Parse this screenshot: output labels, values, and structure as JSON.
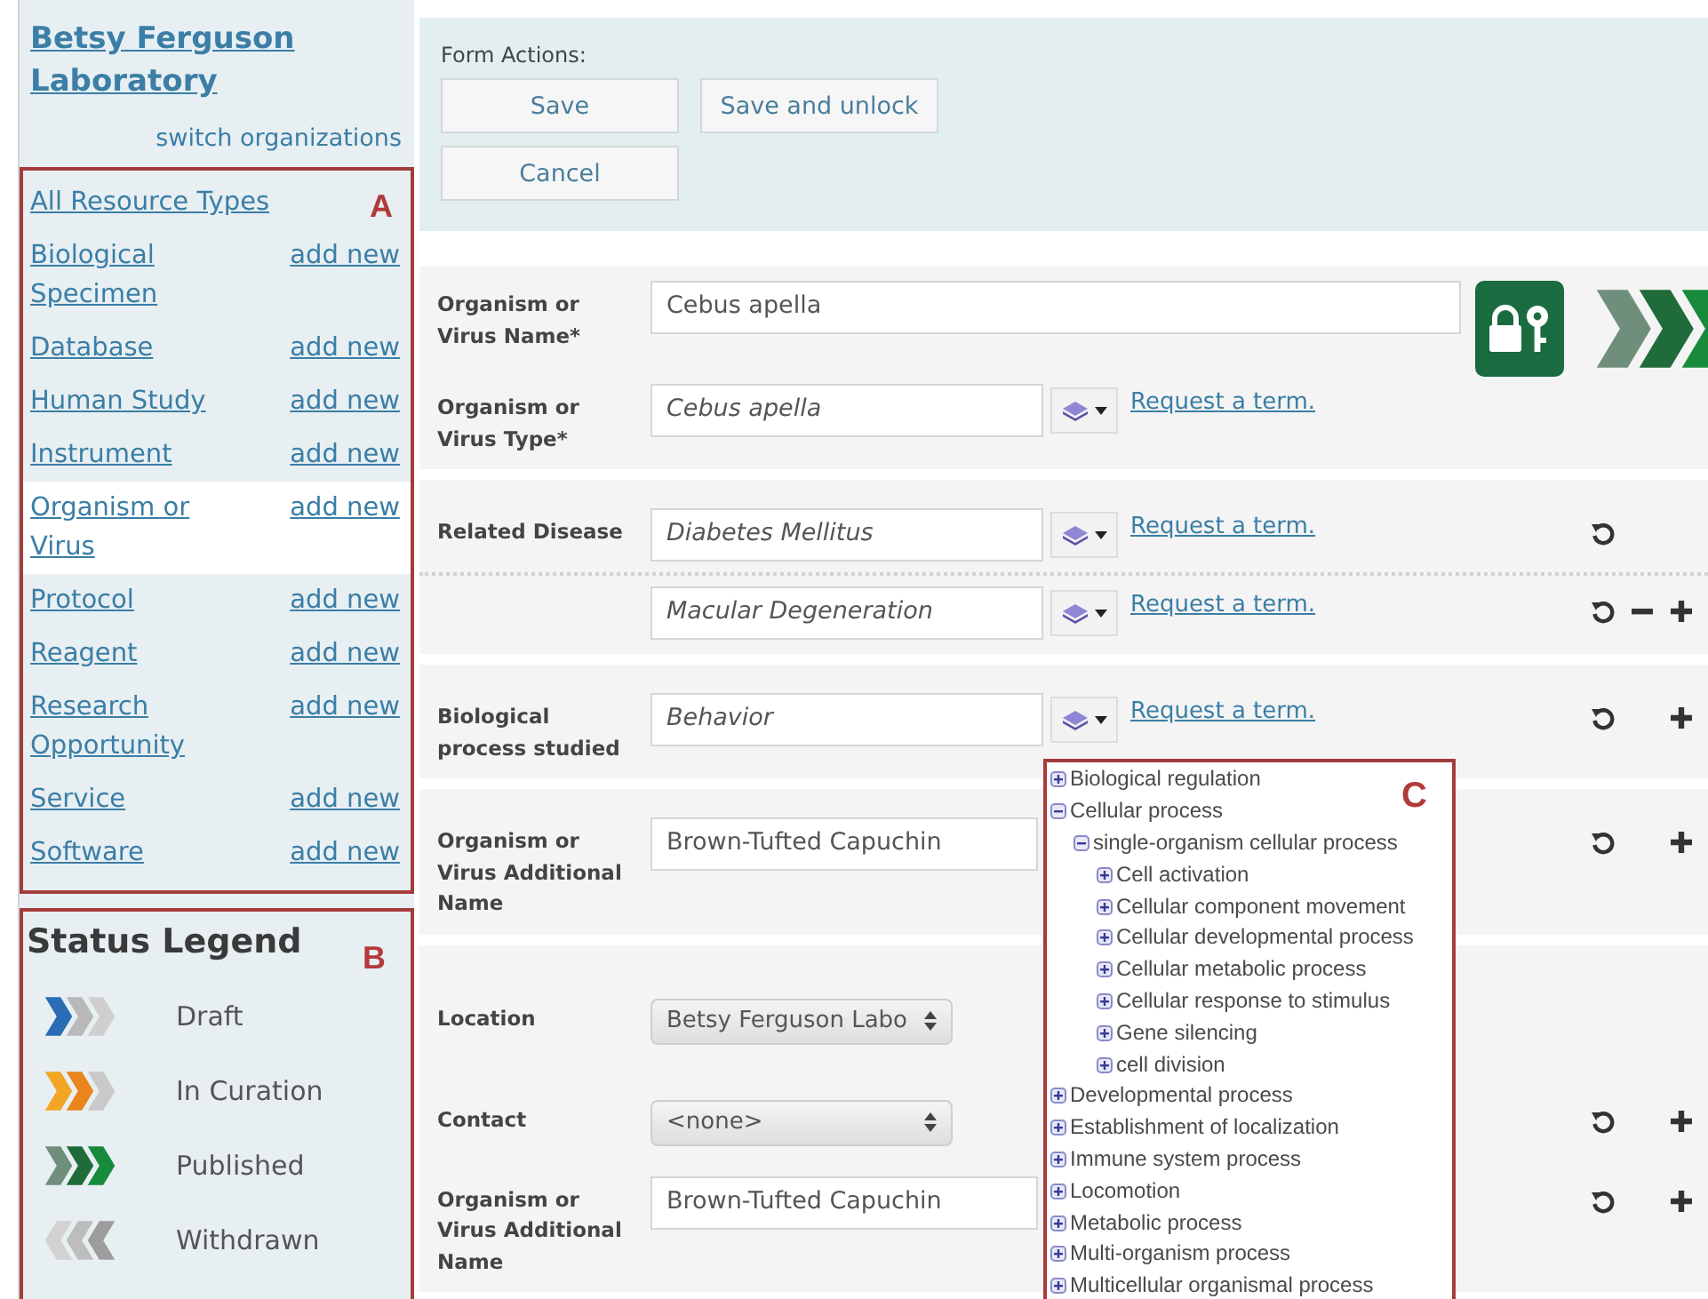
{
  "sidebar": {
    "organization": "Betsy Ferguson Laboratory",
    "switch_link": "switch organizations",
    "resource_types": {
      "callout": "A",
      "items": [
        {
          "label": "All Resource Types",
          "selected": false
        },
        {
          "label": "Biological Specimen",
          "add_link": "add new",
          "selected": false
        },
        {
          "label": "Database",
          "add_link": "add new",
          "selected": false
        },
        {
          "label": "Human Study",
          "add_link": "add new",
          "selected": false
        },
        {
          "label": "Instrument",
          "add_link": "add new",
          "selected": false
        },
        {
          "label": "Organism or Virus",
          "add_link": "add new",
          "selected": true
        },
        {
          "label": "Protocol",
          "add_link": "add new",
          "selected": false
        },
        {
          "label": "Reagent",
          "add_link": "add new",
          "selected": false
        },
        {
          "label": "Research Opportunity",
          "add_link": "add new",
          "selected": false
        },
        {
          "label": "Service",
          "add_link": "add new",
          "selected": false
        },
        {
          "label": "Software",
          "add_link": "add new",
          "selected": false
        }
      ]
    },
    "status_legend": {
      "title": "Status Legend",
      "callout": "B",
      "items": [
        {
          "kind": "draft",
          "label": "Draft"
        },
        {
          "kind": "curation",
          "label": "In Curation"
        },
        {
          "kind": "published",
          "label": "Published"
        },
        {
          "kind": "withdrawn",
          "label": "Withdrawn"
        }
      ]
    }
  },
  "form_actions": {
    "title": "Form Actions:",
    "buttons": [
      "Save",
      "Save and unlock",
      "Cancel"
    ]
  },
  "form": {
    "status_icon": {
      "kind": "published"
    },
    "locked": true,
    "sections": [
      {
        "rows": [
          {
            "kind": "name",
            "label": "Organism or Virus Name*",
            "value": "Cebus apella"
          },
          {
            "kind": "term",
            "label": "Organism or Virus Type*",
            "value": "Cebus apella",
            "link": "Request a term."
          }
        ]
      },
      {
        "rows": [
          {
            "kind": "term",
            "label": "Related Disease",
            "value": "Diabetes Mellitus",
            "link": "Request a term.",
            "actions": [
              {
                "kind": "reset"
              }
            ]
          },
          {
            "kind": "term",
            "dotted_divider": true,
            "value": "Macular Degeneration",
            "link": "Request a term.",
            "actions": [
              {
                "kind": "reset"
              },
              {
                "kind": "remove"
              },
              {
                "kind": "add"
              }
            ]
          }
        ]
      },
      {
        "rows": [
          {
            "kind": "term",
            "label": "Biological process studied",
            "value": "Behavior",
            "link": "Request a term.",
            "actions": [
              {
                "kind": "reset"
              },
              {
                "kind": "add"
              }
            ]
          }
        ]
      },
      {
        "rows": [
          {
            "kind": "text",
            "label": "Organism or Virus Additional Name",
            "value": "Brown-Tufted Capuchin",
            "actions": [
              {
                "kind": "reset"
              },
              {
                "kind": "add"
              }
            ]
          }
        ]
      },
      {
        "rows": [
          {
            "kind": "select",
            "label": "Location",
            "value": "Betsy Ferguson Labo"
          },
          {
            "kind": "select",
            "label": "Contact",
            "value": "<none>",
            "actions": [
              {
                "kind": "reset"
              },
              {
                "kind": "add"
              }
            ]
          },
          {
            "kind": "text",
            "label": "Organism or Virus Additional Name",
            "value": "Brown-Tufted Capuchin",
            "actions": [
              {
                "kind": "reset"
              },
              {
                "kind": "add"
              }
            ]
          }
        ]
      }
    ]
  },
  "term_tree": {
    "callout": "C",
    "items": [
      {
        "label": "Biological regulation",
        "expanded": false
      },
      {
        "label": "Cellular process",
        "expanded": true,
        "children": [
          {
            "label": "single-organism cellular process",
            "expanded": true,
            "children": [
              {
                "label": "Cell activation",
                "expanded": false
              },
              {
                "label": "Cellular component movement",
                "expanded": false
              },
              {
                "label": "Cellular developmental process",
                "expanded": false
              },
              {
                "label": "Cellular metabolic process",
                "expanded": false
              },
              {
                "label": "Cellular response to stimulus",
                "expanded": false
              },
              {
                "label": "Gene silencing",
                "expanded": false
              },
              {
                "label": "cell division",
                "expanded": false
              }
            ]
          }
        ]
      },
      {
        "label": "Developmental process",
        "expanded": false
      },
      {
        "label": "Establishment of localization",
        "expanded": false
      },
      {
        "label": "Immune system process",
        "expanded": false
      },
      {
        "label": "Locomotion",
        "expanded": false
      },
      {
        "label": "Metabolic process",
        "expanded": false
      },
      {
        "label": "Multi-organism process",
        "expanded": false
      },
      {
        "label": "Multicellular organismal process",
        "expanded": false
      }
    ]
  }
}
